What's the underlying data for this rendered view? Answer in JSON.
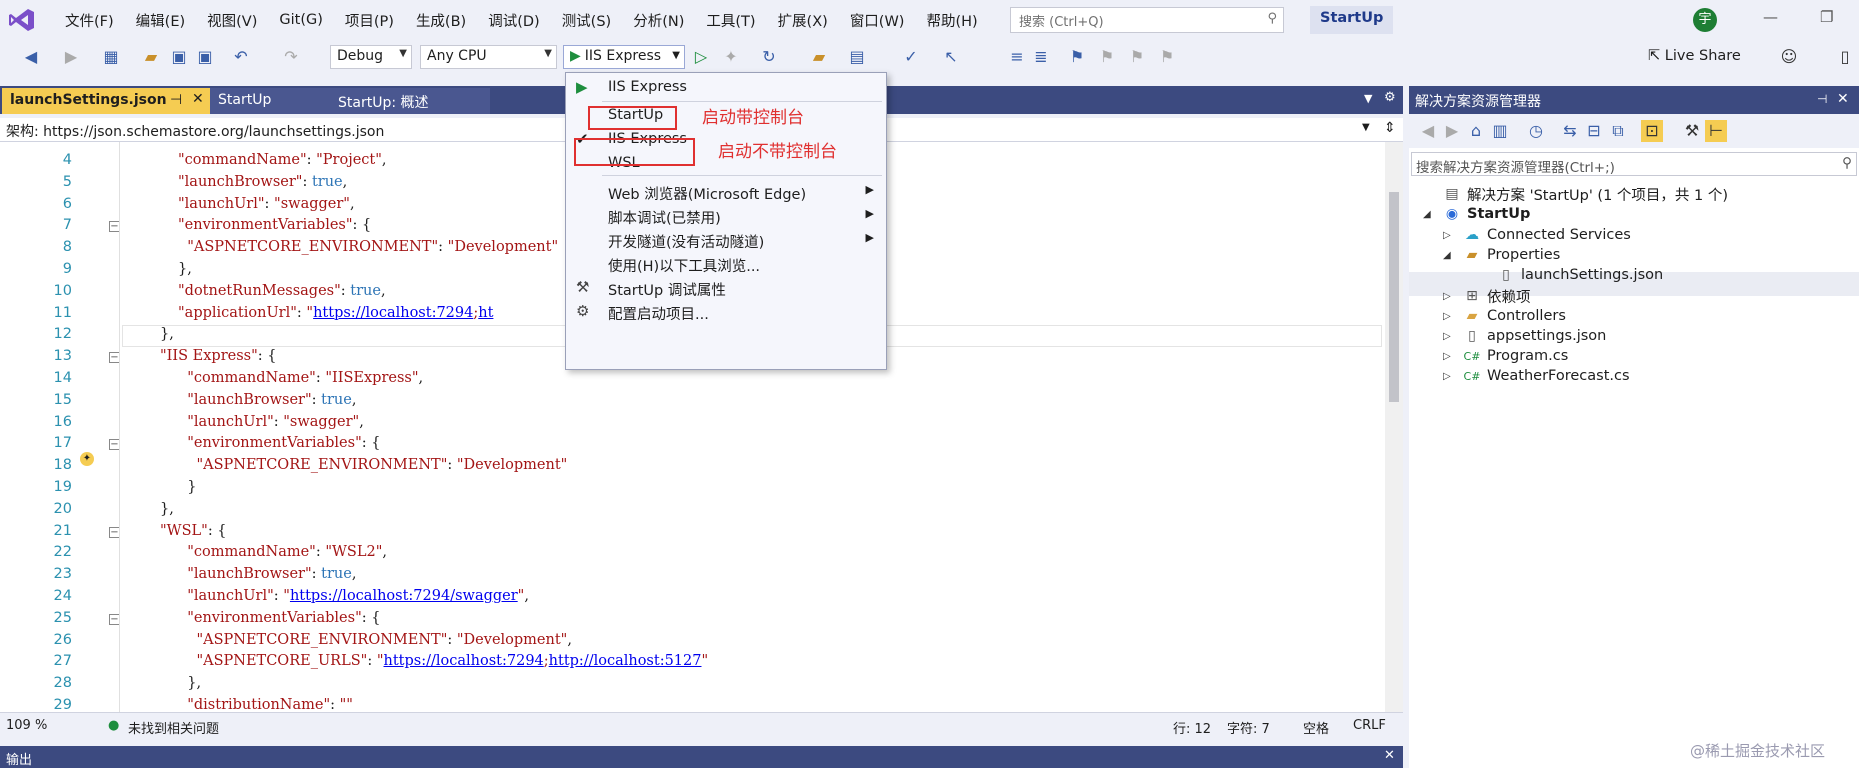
{
  "menubar": {
    "items": [
      "文件(F)",
      "编辑(E)",
      "视图(V)",
      "Git(G)",
      "项目(P)",
      "生成(B)",
      "调试(D)",
      "测试(S)",
      "分析(N)",
      "工具(T)",
      "扩展(X)",
      "窗口(W)",
      "帮助(H)"
    ],
    "search_placeholder": "搜索 (Ctrl+Q)",
    "solution_title": "StartUp",
    "avatar_initial": "宇"
  },
  "toolbar": {
    "config": "Debug",
    "platform": "Any CPU",
    "run_target": "IIS Express",
    "live_share": "Live Share"
  },
  "editor": {
    "tabs": [
      "launchSettings.json",
      "StartUp",
      "StartUp: 概述"
    ],
    "schema_label": "架构:",
    "schema_url": "https://json.schemastore.org/launchsettings.json",
    "lines": [
      {
        "n": "4",
        "html": "<span class='s'>\"commandName\"</span>: <span class='s'>\"Project\"</span>,"
      },
      {
        "n": "5",
        "html": "<span class='s'>\"launchBrowser\"</span>: <span class='k'>true</span>,"
      },
      {
        "n": "6",
        "html": "<span class='s'>\"launchUrl\"</span>: <span class='s'>\"swagger\"</span>,"
      },
      {
        "n": "7",
        "html": "<span class='s'>\"environmentVariables\"</span>: {"
      },
      {
        "n": "8",
        "html": "  <span class='s'>\"ASPNETCORE_ENVIRONMENT\"</span>: <span class='s'>\"Development\"</span>"
      },
      {
        "n": "9",
        "html": "},"
      },
      {
        "n": "10",
        "html": "<span class='s'>\"dotnetRunMessages\"</span>: <span class='k'>true</span>,"
      },
      {
        "n": "11",
        "html": "<span class='s'>\"applicationUrl\"</span>: <span class='s'>\"</span><span class='u'>https://localhost:7294</span><span class='s'>;</span><span class='u'>ht</span>"
      },
      {
        "n": "12",
        "html": "},"
      },
      {
        "n": "13",
        "html": "<span class='s'>\"IIS Express\"</span>: {"
      },
      {
        "n": "14",
        "html": "  <span class='s'>\"commandName\"</span>: <span class='s'>\"IISExpress\"</span>,"
      },
      {
        "n": "15",
        "html": "  <span class='s'>\"launchBrowser\"</span>: <span class='k'>true</span>,"
      },
      {
        "n": "16",
        "html": "  <span class='s'>\"launchUrl\"</span>: <span class='s'>\"swagger\"</span>,"
      },
      {
        "n": "17",
        "html": "  <span class='s'>\"environmentVariables\"</span>: {"
      },
      {
        "n": "18",
        "html": "    <span class='s'>\"ASPNETCORE_ENVIRONMENT\"</span>: <span class='s'>\"Development\"</span>"
      },
      {
        "n": "19",
        "html": "  }"
      },
      {
        "n": "20",
        "html": "},"
      },
      {
        "n": "21",
        "html": "<span class='s'>\"WSL\"</span>: {"
      },
      {
        "n": "22",
        "html": "  <span class='s'>\"commandName\"</span>: <span class='s'>\"WSL2\"</span>,"
      },
      {
        "n": "23",
        "html": "  <span class='s'>\"launchBrowser\"</span>: <span class='k'>true</span>,"
      },
      {
        "n": "24",
        "html": "  <span class='s'>\"launchUrl\"</span>: <span class='s'>\"</span><span class='u'>https://localhost:7294/swagger</span><span class='s'>\"</span>,"
      },
      {
        "n": "25",
        "html": "  <span class='s'>\"environmentVariables\"</span>: {"
      },
      {
        "n": "26",
        "html": "    <span class='s'>\"ASPNETCORE_ENVIRONMENT\"</span>: <span class='s'>\"Development\"</span>,"
      },
      {
        "n": "27",
        "html": "    <span class='s'>\"ASPNETCORE_URLS\"</span>: <span class='s'>\"</span><span class='u'>https://localhost:7294</span><span class='s'>;</span><span class='u'>http://localhost:5127</span><span class='s'>\"</span>"
      },
      {
        "n": "28",
        "html": "  },"
      },
      {
        "n": "29",
        "html": "  <span class='s'>\"distributionName\"</span>: <span class='s'>\"\"</span>"
      }
    ]
  },
  "status": {
    "zoom": "109 %",
    "issues": "未找到相关问题",
    "line": "行: 12",
    "col": "字符: 7",
    "whitespace": "空格",
    "eol": "CRLF",
    "output_title": "输出"
  },
  "run_menu": {
    "items": [
      {
        "label": "IIS Express",
        "glyph": "play-icon"
      },
      {
        "label": "StartUp",
        "glyph": ""
      },
      {
        "label": "IIS Express",
        "glyph": "check-icon"
      },
      {
        "label": "WSL",
        "glyph": ""
      },
      {
        "label": "Web 浏览器(Microsoft Edge)",
        "glyph": "",
        "submenu": true
      },
      {
        "label": "脚本调试(已禁用)",
        "glyph": "",
        "submenu": true
      },
      {
        "label": "开发隧道(没有活动隧道)",
        "glyph": "",
        "submenu": true
      },
      {
        "label": "使用(H)以下工具浏览...",
        "glyph": ""
      },
      {
        "label": "StartUp 调试属性",
        "glyph": "wrench-icon"
      },
      {
        "label": "配置启动项目...",
        "glyph": "gear-icon"
      }
    ],
    "annotation_console": "启动带控制台",
    "annotation_no_console": "启动不带控制台"
  },
  "solution_explorer": {
    "title": "解决方案资源管理器",
    "search_placeholder": "搜索解决方案资源管理器(Ctrl+;)",
    "tree": [
      {
        "label": "解决方案 'StartUp' (1 个项目，共 1 个)",
        "icon": "solution-icon"
      },
      {
        "label": "StartUp",
        "icon": "project-icon"
      },
      {
        "label": "Connected Services",
        "icon": "cloud-icon"
      },
      {
        "label": "Properties",
        "icon": "folder-wrench-icon"
      },
      {
        "label": "launchSettings.json",
        "icon": "json-file-icon"
      },
      {
        "label": "依赖项",
        "icon": "dependencies-icon"
      },
      {
        "label": "Controllers",
        "icon": "folder-icon"
      },
      {
        "label": "appsettings.json",
        "icon": "json-file-icon"
      },
      {
        "label": "Program.cs",
        "icon": "csharp-icon"
      },
      {
        "label": "WeatherForecast.cs",
        "icon": "csharp-icon"
      }
    ]
  },
  "watermark": "@稀土掘金技术社区",
  "colors": {
    "accent": "#3c4a80",
    "tab_active": "#f5cc52",
    "annotation": "#e03030",
    "play": "#1e8e3e"
  }
}
